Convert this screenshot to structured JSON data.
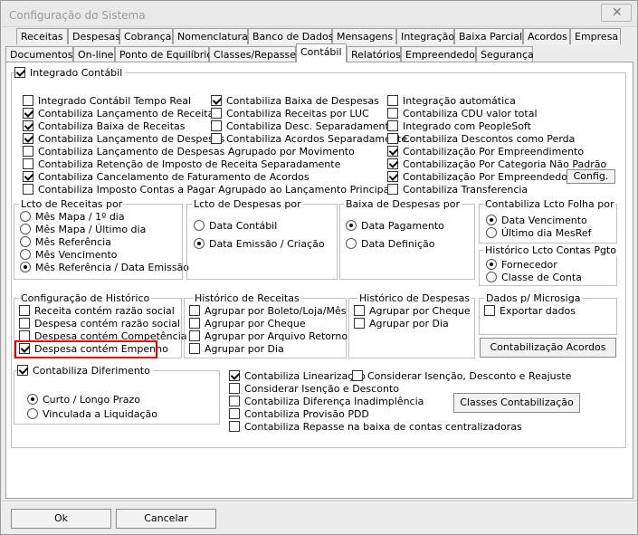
{
  "window": {
    "title": "Configuração do Sistema",
    "close": "✕"
  },
  "tabs_row1": [
    "Receitas",
    "Despesas",
    "Cobrança",
    "Nomenclatura",
    "Banco de Dados",
    "Mensagens",
    "Integração",
    "Baixa Parcial",
    "Acordos",
    "Empresa"
  ],
  "tabs_row2": [
    "Documentos",
    "On-line",
    "Ponto de Equilíbrio",
    "Classes/Repasse",
    "Contábil",
    "Relatórios",
    "Empreendedor",
    "Segurança"
  ],
  "main": {
    "integrado": "Integrado Contábil",
    "col1": [
      "Integrado Contábil Tempo Real",
      "Contabiliza Lançamento de Receitas",
      "Contabiliza Baixa de Receitas",
      "Contabiliza Lançamento de Despesas",
      "Contabiliza Lançamento de Despesas Agrupado por Movimento",
      "Contabiliza Retenção de Imposto de Receita Separadamente",
      "Contabiliza Cancelamento de Faturamento de Acordos",
      "Contabiliza Imposto Contas a Pagar Agrupado ao Lançamento Principal"
    ],
    "col2": [
      "Contabiliza Baixa de Despesas",
      "Contabiliza Receitas por LUC",
      "Contabiliza Desc. Separadamente",
      "Contabiliza Acordos Separadamente"
    ],
    "col3": [
      "Integração automática",
      "Contabiliza CDU valor total",
      "Integrado com PeopleSoft",
      "Contabiliza Descontos como Perda",
      "Contabilização Por Empreendimento",
      "Contabilização Por Categoria Não Padrão",
      "Contabilização Por Empreendedor",
      "Contabiliza Transferencia"
    ],
    "config_btn": "Config."
  },
  "groups": {
    "lcto_receitas": {
      "title": "Lcto de Receitas por",
      "options": [
        "Mês Mapa / 1º dia",
        "Mês Mapa / Último dia",
        "Mês Referência",
        "Mês Vencimento",
        "Mês Referência / Data Emissão"
      ]
    },
    "lcto_despesas": {
      "title": "Lcto de Despesas por",
      "options": [
        "Data Contábil",
        "Data Emissão / Criação"
      ]
    },
    "baixa_despesas": {
      "title": "Baixa de Despesas por",
      "options": [
        "Data Pagamento",
        "Data Definição"
      ]
    },
    "folha": {
      "title": "Contabiliza Lcto Folha por",
      "options": [
        "Data Vencimento",
        "Último dia MesRef"
      ]
    },
    "historico_pgto": {
      "title": "Histórico Lcto Contas Pgto",
      "options": [
        "Fornecedor",
        "Classe de Conta"
      ]
    },
    "config_historico": {
      "title": "Configuração de Histórico",
      "options": [
        "Receita contém razão social",
        "Despesa contém razão social",
        "Despesa contém Competência",
        "Despesa contém Empenho"
      ]
    },
    "hist_receitas": {
      "title": "Histórico de Receitas",
      "options": [
        "Agrupar por Boleto/Loja/Mês",
        "Agrupar por Cheque",
        "Agrupar por Arquivo Retorno",
        "Agrupar por Dia"
      ]
    },
    "hist_despesas": {
      "title": "Histórico de Despesas",
      "options": [
        "Agrupar por Cheque",
        "Agrupar por Dia"
      ]
    },
    "microsiga": {
      "title": "Dados p/ Microsiga",
      "options": [
        "Exportar dados"
      ],
      "button": "Contabilização Acordos"
    },
    "diferimento": {
      "title": "Contabiliza Diferimento",
      "options": [
        "Curto / Longo Prazo",
        "Vinculada a Liquidação"
      ]
    }
  },
  "bottom_checks": [
    "Contabiliza Linearização",
    "Considerar Isenção, Desconto e Reajuste",
    "Considerar Isenção e Desconto",
    "Contabiliza Diferença Inadimplência",
    "Contabiliza Provisão PDD",
    "Contabiliza Repasse na baixa de contas centralizadoras"
  ],
  "classes_btn": "Classes Contabilização",
  "footer": {
    "ok": "Ok",
    "cancel": "Cancelar"
  }
}
